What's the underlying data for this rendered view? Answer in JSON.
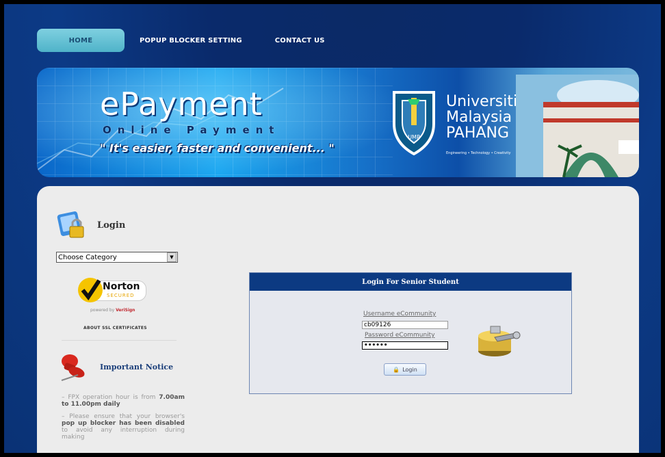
{
  "nav": {
    "items": [
      "HOME",
      "POPUP BLOCKER SETTING",
      "CONTACT US"
    ]
  },
  "banner": {
    "title": "ePayment",
    "subtitle": "Online Payment",
    "tagline": "\" It's easier, faster and convenient... \"",
    "university": {
      "line1": "Universiti",
      "line2": "Malaysia",
      "line3": "PAHANG",
      "motto": "Engineering • Technology • Creativity",
      "shield_text": "UMP"
    }
  },
  "sidebar": {
    "login_label": "Login",
    "category_select": "Choose Category",
    "norton": {
      "name": "Norton",
      "secured": "SECURED",
      "powered_by": "powered by",
      "brand": "VeriSign"
    },
    "ssl_link": "ABOUT SSL CERTIFICATES",
    "notice_title": "Important Notice",
    "notice_1_prefix": "FPX operation hour is from",
    "notice_1_bold": "7.00am to 11.00pm daily",
    "notice_2_prefix": "Please ensure that your browser's",
    "notice_2_bold": "pop up blocker has been disabled",
    "notice_2_suffix": "to avoid any interruption during making"
  },
  "login_box": {
    "title": "Login For Senior Student",
    "username_label": "Username eCommunity",
    "username_value": "cb09126",
    "password_label": "Password eCommunity",
    "password_value": "••••••",
    "login_button": "Login"
  },
  "colors": {
    "page_bg": "#0a2a6b",
    "nav_home": "#5fc1d4",
    "login_header": "#0c3a82",
    "panel": "#ececec"
  }
}
